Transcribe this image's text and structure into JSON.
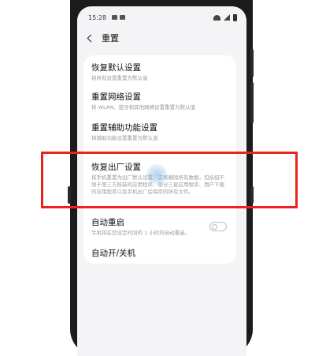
{
  "status_bar": {
    "time": "15:28"
  },
  "header": {
    "title": "重置"
  },
  "items": [
    {
      "title": "恢复默认设置",
      "desc": "将所有设置重置为默认值"
    },
    {
      "title": "重置网络设置",
      "desc": "将 WLAN、蓝牙和其他网络设置重置为默认值"
    },
    {
      "title": "重置辅助功能设置",
      "desc": "将辅助功能设置重置为默认值"
    },
    {
      "title": "恢复出厂设置",
      "desc": "将手机重置为出厂默认设置。这将删除所有数据，包括但不限于第三方既装的应用程序、部分三星应用程序、用户下载的应用程序以及手机出厂后保存的所有文件。"
    },
    {
      "title": "自动重启",
      "desc": "手机将在您设定时间的 1 小时内自动重启。",
      "toggle_on": false
    },
    {
      "title": "自动开/关机"
    }
  ],
  "colors": {
    "highlight": "#e8241c",
    "screen_bg": "#f4f4f6",
    "phone_body": "#1c1c1c"
  }
}
